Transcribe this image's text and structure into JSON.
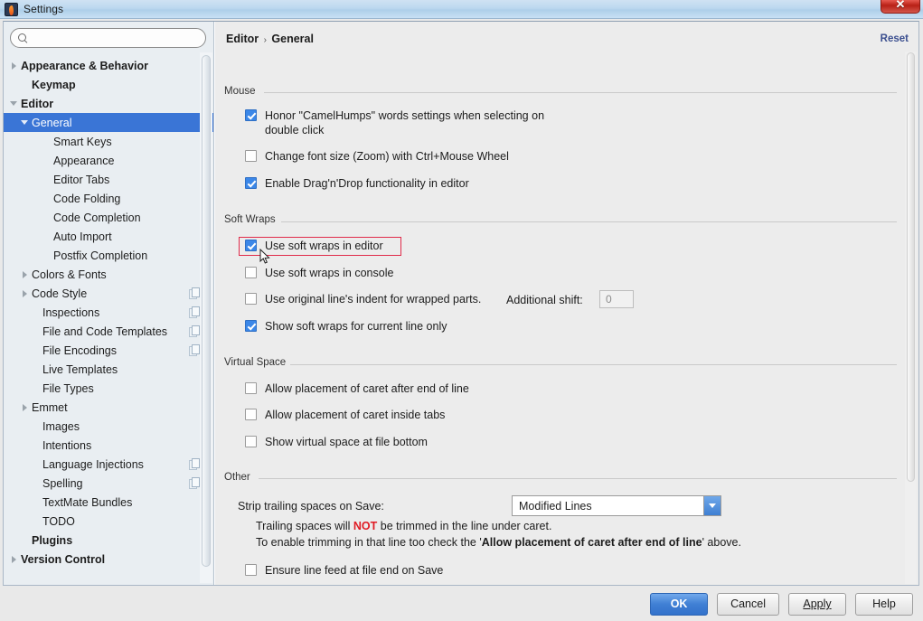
{
  "window": {
    "title": "Settings",
    "app_icon": "intellij-icon",
    "close_label": "✕"
  },
  "sidebar": {
    "search": {
      "value": "",
      "placeholder": "",
      "icon": "search-icon"
    },
    "items": [
      {
        "label": "Appearance & Behavior",
        "indent": 0,
        "arrow": "closed",
        "bold": true,
        "selected": false,
        "copy": false
      },
      {
        "label": "Keymap",
        "indent": 1,
        "arrow": "none",
        "bold": true,
        "selected": false,
        "copy": false
      },
      {
        "label": "Editor",
        "indent": 0,
        "arrow": "open",
        "bold": true,
        "selected": false,
        "copy": false
      },
      {
        "label": "General",
        "indent": 1,
        "arrow": "open",
        "bold": false,
        "selected": true,
        "copy": false
      },
      {
        "label": "Smart Keys",
        "indent": 3,
        "arrow": "none",
        "bold": false,
        "selected": false,
        "copy": false
      },
      {
        "label": "Appearance",
        "indent": 3,
        "arrow": "none",
        "bold": false,
        "selected": false,
        "copy": false
      },
      {
        "label": "Editor Tabs",
        "indent": 3,
        "arrow": "none",
        "bold": false,
        "selected": false,
        "copy": false
      },
      {
        "label": "Code Folding",
        "indent": 3,
        "arrow": "none",
        "bold": false,
        "selected": false,
        "copy": false
      },
      {
        "label": "Code Completion",
        "indent": 3,
        "arrow": "none",
        "bold": false,
        "selected": false,
        "copy": false
      },
      {
        "label": "Auto Import",
        "indent": 3,
        "arrow": "none",
        "bold": false,
        "selected": false,
        "copy": false
      },
      {
        "label": "Postfix Completion",
        "indent": 3,
        "arrow": "none",
        "bold": false,
        "selected": false,
        "copy": false
      },
      {
        "label": "Colors & Fonts",
        "indent": 1,
        "arrow": "closed",
        "bold": false,
        "selected": false,
        "copy": false
      },
      {
        "label": "Code Style",
        "indent": 1,
        "arrow": "closed",
        "bold": false,
        "selected": false,
        "copy": true
      },
      {
        "label": "Inspections",
        "indent": 2,
        "arrow": "none",
        "bold": false,
        "selected": false,
        "copy": true
      },
      {
        "label": "File and Code Templates",
        "indent": 2,
        "arrow": "none",
        "bold": false,
        "selected": false,
        "copy": true
      },
      {
        "label": "File Encodings",
        "indent": 2,
        "arrow": "none",
        "bold": false,
        "selected": false,
        "copy": true
      },
      {
        "label": "Live Templates",
        "indent": 2,
        "arrow": "none",
        "bold": false,
        "selected": false,
        "copy": false
      },
      {
        "label": "File Types",
        "indent": 2,
        "arrow": "none",
        "bold": false,
        "selected": false,
        "copy": false
      },
      {
        "label": "Emmet",
        "indent": 1,
        "arrow": "closed",
        "bold": false,
        "selected": false,
        "copy": false
      },
      {
        "label": "Images",
        "indent": 2,
        "arrow": "none",
        "bold": false,
        "selected": false,
        "copy": false
      },
      {
        "label": "Intentions",
        "indent": 2,
        "arrow": "none",
        "bold": false,
        "selected": false,
        "copy": false
      },
      {
        "label": "Language Injections",
        "indent": 2,
        "arrow": "none",
        "bold": false,
        "selected": false,
        "copy": true
      },
      {
        "label": "Spelling",
        "indent": 2,
        "arrow": "none",
        "bold": false,
        "selected": false,
        "copy": true
      },
      {
        "label": "TextMate Bundles",
        "indent": 2,
        "arrow": "none",
        "bold": false,
        "selected": false,
        "copy": false
      },
      {
        "label": "TODO",
        "indent": 2,
        "arrow": "none",
        "bold": false,
        "selected": false,
        "copy": false
      },
      {
        "label": "Plugins",
        "indent": 1,
        "arrow": "none",
        "bold": true,
        "selected": false,
        "copy": false
      },
      {
        "label": "Version Control",
        "indent": 0,
        "arrow": "closed",
        "bold": true,
        "selected": false,
        "copy": false
      }
    ]
  },
  "content": {
    "breadcrumb": {
      "root": "Editor",
      "separator": "›",
      "leaf": "General"
    },
    "reset_label": "Reset",
    "groups": {
      "mouse": {
        "title": "Mouse",
        "options": [
          {
            "label": "Honor \"CamelHumps\" words settings when selecting on double click",
            "checked": true
          },
          {
            "label": "Change font size (Zoom) with Ctrl+Mouse Wheel",
            "checked": false
          },
          {
            "label": "Enable Drag'n'Drop functionality in editor",
            "checked": true
          }
        ]
      },
      "soft_wraps": {
        "title": "Soft Wraps",
        "options": [
          {
            "label": "Use soft wraps in editor",
            "checked": true,
            "highlighted": true
          },
          {
            "label": "Use soft wraps in console",
            "checked": false,
            "highlighted": false
          },
          {
            "label": "Use original line's indent for wrapped parts.",
            "checked": false,
            "highlighted": false
          },
          {
            "label": "Show soft wraps for current line only",
            "checked": true,
            "highlighted": false
          }
        ],
        "additional_shift_label": "Additional shift:",
        "additional_shift_value": "0"
      },
      "virtual_space": {
        "title": "Virtual Space",
        "options": [
          {
            "label": "Allow placement of caret after end of line",
            "checked": false
          },
          {
            "label": "Allow placement of caret inside tabs",
            "checked": false
          },
          {
            "label": "Show virtual space at file bottom",
            "checked": false
          }
        ]
      },
      "other": {
        "title": "Other",
        "strip_label": "Strip trailing spaces on Save:",
        "strip_value": "Modified Lines",
        "note_line1_a": "Trailing spaces will ",
        "note_line1_red": "NOT",
        "note_line1_b": " be trimmed in the line under caret.",
        "note_line2_a": "To enable trimming in that line too check the '",
        "note_line2_b": "Allow placement of caret after end of line",
        "note_line2_c": "' above.",
        "ensure_label": "Ensure line feed at file end on Save",
        "ensure_checked": false
      }
    }
  },
  "buttons": {
    "ok": "OK",
    "cancel": "Cancel",
    "apply": "Apply",
    "help": "Help"
  },
  "colors": {
    "accent": "#3a75d6",
    "highlight": "#e02b4a",
    "warning": "#e01b24",
    "link": "#3b4f8f"
  }
}
